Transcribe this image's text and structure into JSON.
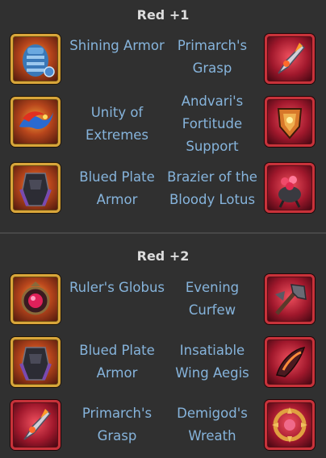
{
  "sections": [
    {
      "title": "Red +1",
      "rows": [
        {
          "left_label": "Shining Armor",
          "right_label": "Primarch's Grasp",
          "left_icon": "shining-armor-icon",
          "right_icon": "primarchs-grasp-icon"
        },
        {
          "left_label": "Unity of Extremes",
          "right_label": "Andvari's Fortitude Support",
          "left_icon": "unity-of-extremes-icon",
          "right_icon": "andvaris-fortitude-support-icon"
        },
        {
          "left_label": "Blued Plate Armor",
          "right_label": "Brazier of the Bloody Lotus",
          "left_icon": "blued-plate-armor-icon",
          "right_icon": "brazier-of-the-bloody-lotus-icon"
        }
      ]
    },
    {
      "title": "Red +2",
      "rows": [
        {
          "left_label": "Ruler's Globus",
          "right_label": "Evening Curfew",
          "left_icon": "rulers-globus-icon",
          "right_icon": "evening-curfew-icon"
        },
        {
          "left_label": "Blued Plate Armor",
          "right_label": "Insatiable Wing Aegis",
          "left_icon": "blued-plate-armor-icon",
          "right_icon": "insatiable-wing-aegis-icon"
        },
        {
          "left_label": "Primarch's Grasp",
          "right_label": "Demigod's Wreath",
          "left_icon": "primarchs-grasp-icon",
          "right_icon": "demigods-wreath-icon"
        }
      ]
    }
  ],
  "colors": {
    "background": "#303030",
    "divider": "#474747",
    "title_text": "#dcdcdc",
    "item_text": "#86b4dc",
    "gold_frame": "#d9a63a",
    "red_frame": "#c8323a"
  }
}
